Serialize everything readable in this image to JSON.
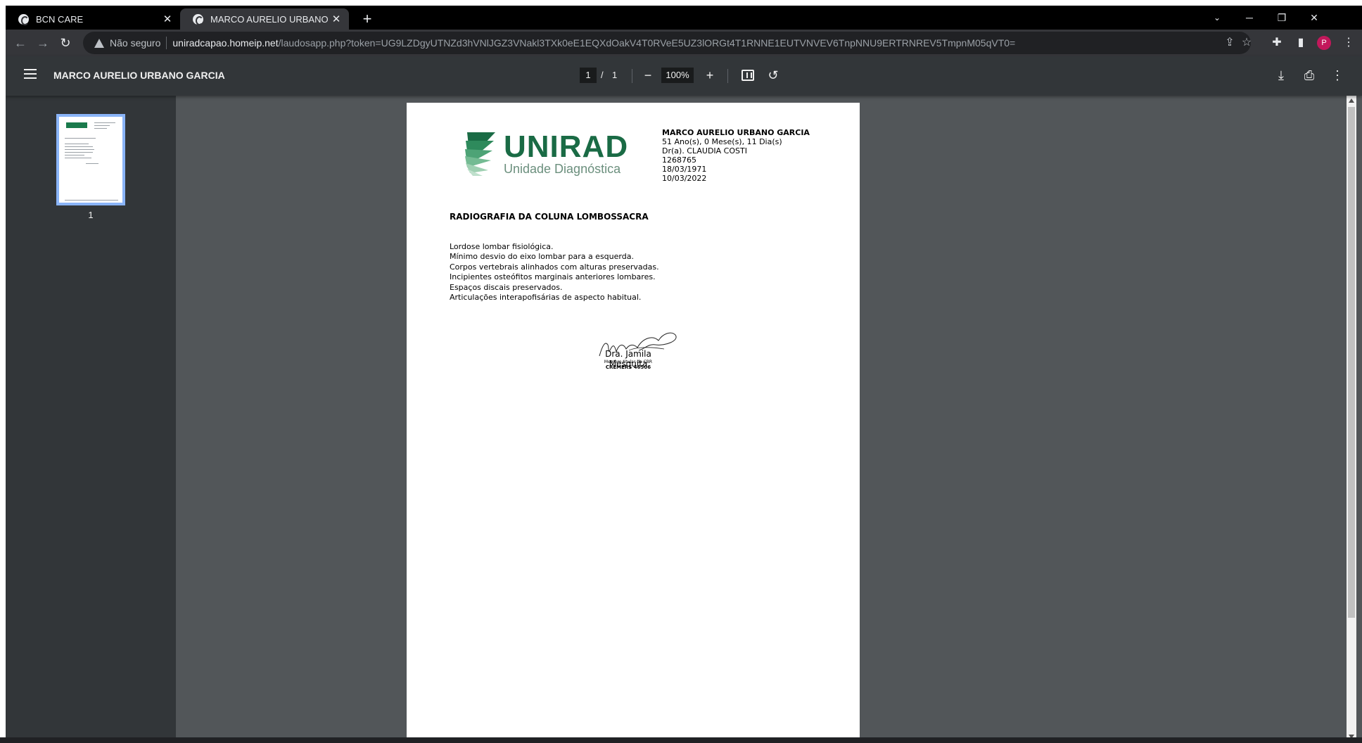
{
  "tabs": [
    {
      "title": "BCN CARE"
    },
    {
      "title": "MARCO AURELIO URBANO GARC"
    }
  ],
  "icons": {
    "new_tab": "+",
    "tab_close": "✕",
    "minimize": "─",
    "restore": "❐",
    "window_close": "✕",
    "back": "←",
    "forward": "→",
    "reload": "↻",
    "share": "⇪",
    "star": "☆",
    "extensions": "✚",
    "sidepanel": "▮",
    "more": "⋮",
    "zoom_out": "−",
    "zoom_in": "+",
    "rotate": "↺",
    "download": "⤓",
    "print": "⎙"
  },
  "omnibox": {
    "security_label": "Não seguro",
    "host": "uniradcapao.homeip.net",
    "path": "/laudosapp.php?token=UG9LZDgyUTNZd3hVNlJGZ3VNakl3TXk0eE1EQXdOakV4T0RVeE5UZ3lORGt4T1RNNE1EUTVNVEV6TnpNNU9ERTRNREV5TmpnM05qVT0="
  },
  "profile": {
    "initial": "P",
    "color": "#c2185b"
  },
  "pdf_toolbar": {
    "title": "MARCO AURELIO URBANO GARCIA",
    "current_page": "1",
    "separator": "/",
    "total_pages": "1",
    "zoom": "100%"
  },
  "sidebar": {
    "thumbnail_label": "1"
  },
  "document": {
    "logo": {
      "word": "UNIRAD",
      "reg": "®",
      "subtitle": "Unidade Diagnóstica",
      "brand_color": "#1a6b45"
    },
    "patient": {
      "name": "MARCO AURELIO URBANO GARCIA",
      "age": "51 Ano(s), 0 Mese(s), 11 Dia(s)",
      "doctor": "Dr(a). CLAUDIA COSTI",
      "id": "1268765",
      "birth_date": "18/03/1971",
      "exam_date": "10/03/2022"
    },
    "exam_title": "RADIOGRAFIA DA COLUNA LOMBOSSACRA",
    "findings": [
      "Lordose lombar fisiológica.",
      "Mínimo desvio do eixo lombar para a esquerda.",
      "Corpos vertebrais alinhados com alturas preservadas.",
      "Incipientes osteófitos marginais anteriores lombares.",
      "Espaços discais preservados.",
      "Articulações interapofisárias de aspecto habitual."
    ],
    "signature": {
      "name": "Dra. Jamila Mesquita",
      "title": "Membro titular do CBR",
      "registry": "CREMERS 46506"
    }
  },
  "colors": {
    "tab_active": "#35363a",
    "pdf_toolbar": "#323639",
    "viewer_bg": "#525659",
    "thumb_selected": "#8ab4f8"
  }
}
